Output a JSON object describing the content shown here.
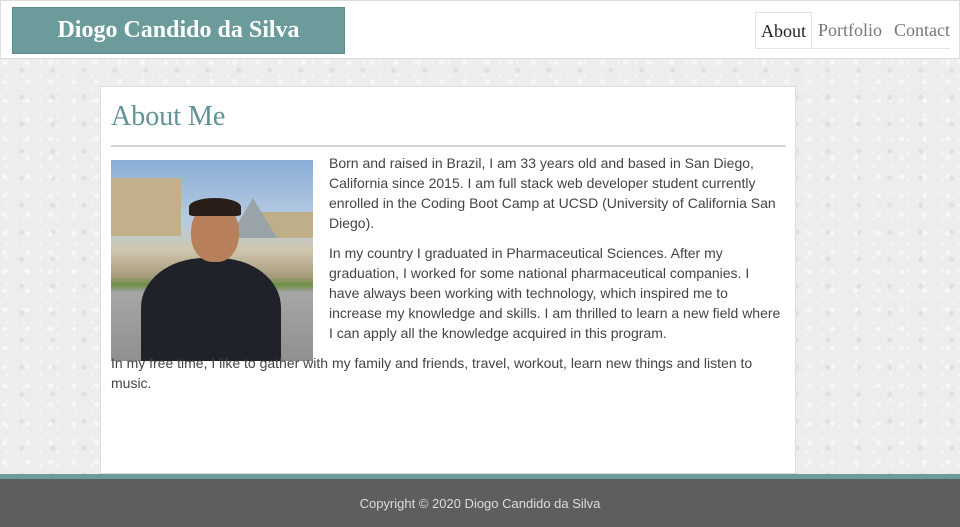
{
  "brand": "Diogo Candido da Silva",
  "nav": {
    "items": [
      "About",
      "Portfolio",
      "Contact"
    ],
    "active": "About"
  },
  "about": {
    "title": "About Me",
    "photo_alt": "Diogo in front of the Louvre pyramid",
    "paragraphs": [
      "Born and raised in Brazil, I am 33 years old and based in San Diego, California since 2015. I am full stack web developer student currently enrolled in the Coding Boot Camp at UCSD (University of California San Diego).",
      "In my country I graduated in Pharmaceutical Sciences. After my graduation, I worked for some national pharmaceutical companies. I have always been working with technology, which inspired me to increase my knowledge and skills. I am thrilled to learn a new field where I can apply all the knowledge acquired in this program.",
      "In my free time, I like to gather with my family and friends, travel, workout, learn new things and listen to music."
    ]
  },
  "footer": {
    "copyright": "Copyright © 2020 Diogo Candido da Silva"
  },
  "colors": {
    "accent": "#6b9b9b",
    "heading": "#5f9497",
    "footer_bg": "#5e5e5e"
  }
}
